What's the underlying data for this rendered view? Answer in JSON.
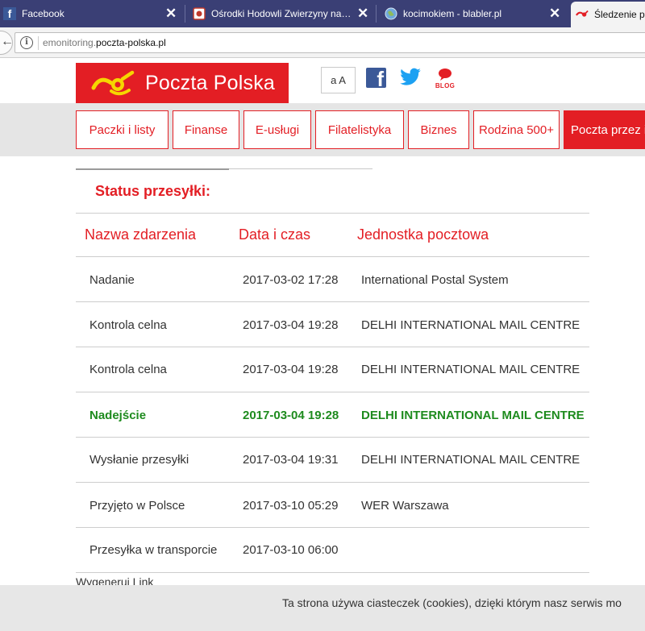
{
  "browser": {
    "tabs": [
      {
        "title": "Facebook",
        "icon": "facebook-icon"
      },
      {
        "title": "Ośrodki Hodowli Zwierzyny na…",
        "icon": "page-icon"
      },
      {
        "title": "kocimokiem - blabler.pl",
        "icon": "globe-icon"
      },
      {
        "title": "Śledzenie pr",
        "icon": "poczta-logo-icon"
      }
    ],
    "close_glyph": "✕",
    "url_prefix": "emonitoring.",
    "url_domain": "poczta-polska.pl"
  },
  "header": {
    "logo_text": "Poczta Polska",
    "font_size_button": "a A",
    "blog_label": "BLOG",
    "colors": {
      "brand_red": "#e31e24",
      "facebook_blue": "#3b5998",
      "twitter_blue": "#1da1f2"
    }
  },
  "nav": {
    "items": [
      {
        "label": "Paczki i listy"
      },
      {
        "label": "Finanse"
      },
      {
        "label": "E-usługi"
      },
      {
        "label": "Filatelistyka"
      },
      {
        "label": "Biznes"
      },
      {
        "label": "Rodzina 500+"
      },
      {
        "label": "Poczta przez i"
      }
    ]
  },
  "tracking": {
    "section_title": "Status przesyłki:",
    "headers": {
      "event": "Nazwa zdarzenia",
      "datetime": "Data i czas",
      "office": "Jednostka pocztowa"
    },
    "rows": [
      {
        "event": "Nadanie",
        "datetime": "2017-03-02 17:28",
        "office": "International Postal System"
      },
      {
        "event": "Kontrola celna",
        "datetime": "2017-03-04 19:28",
        "office": "DELHI INTERNATIONAL MAIL CENTRE"
      },
      {
        "event": "Kontrola celna",
        "datetime": "2017-03-04 19:28",
        "office": "DELHI INTERNATIONAL MAIL CENTRE"
      },
      {
        "event": "Nadejście",
        "datetime": "2017-03-04 19:28",
        "office": "DELHI INTERNATIONAL MAIL CENTRE"
      },
      {
        "event": "Wysłanie przesyłki",
        "datetime": "2017-03-04 19:31",
        "office": "DELHI INTERNATIONAL MAIL CENTRE"
      },
      {
        "event": "Przyjęto w Polsce",
        "datetime": "2017-03-10 05:29",
        "office": "WER Warszawa"
      },
      {
        "event": "Przesyłka w transporcie",
        "datetime": "2017-03-10 06:00",
        "office": ""
      }
    ],
    "highlight_color": "#1e8b1e",
    "generate_link": "Wygeneruj Link"
  },
  "cookie_notice": "Ta strona używa ciasteczek (cookies), dzięki którym nasz serwis mo"
}
